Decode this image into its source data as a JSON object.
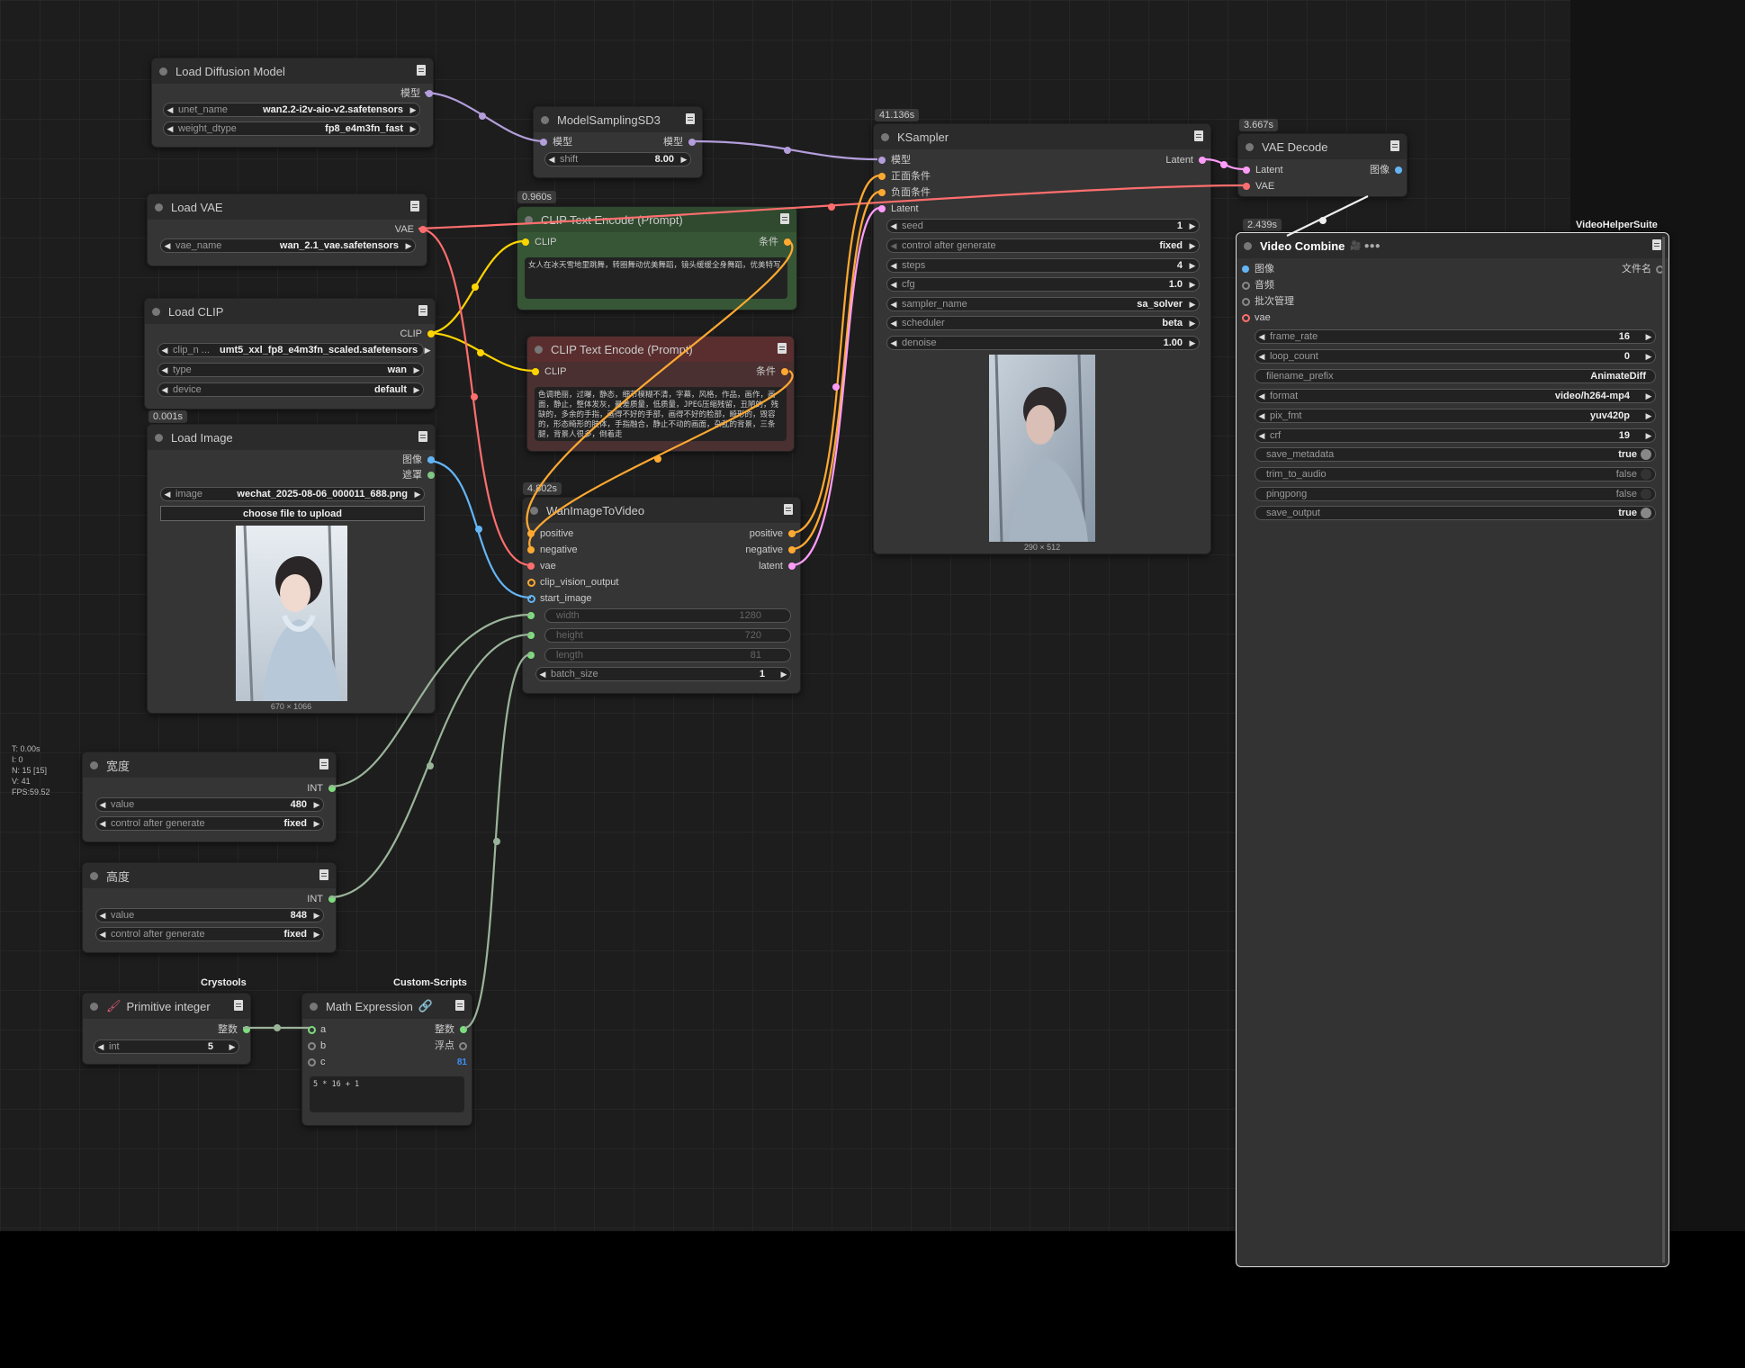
{
  "stats": [
    "T: 0.00s",
    "I: 0",
    "N: 15 [15]",
    "V: 41",
    "FPS:59.52"
  ],
  "colors": {
    "model": "#b39ddb",
    "clip": "#ffd500",
    "vae": "#ff6e6e",
    "conditioning": "#ffa931",
    "latent": "#ff9cf9",
    "image": "#64b5f6",
    "int": "#7cdd7c",
    "mask": "#81c784"
  },
  "nodes": {
    "load_diffusion": {
      "title": "Load Diffusion Model",
      "out": "模型",
      "w1_label": "unet_name",
      "w1_value": "wan2.2-i2v-aio-v2.safetensors",
      "w2_label": "weight_dtype",
      "w2_value": "fp8_e4m3fn_fast"
    },
    "model_sampling": {
      "title": "ModelSamplingSD3",
      "in": "模型",
      "out": "模型",
      "w_label": "shift",
      "w_value": "8.00"
    },
    "load_vae": {
      "title": "Load VAE",
      "out": "VAE",
      "w_label": "vae_name",
      "w_value": "wan_2.1_vae.safetensors"
    },
    "load_clip": {
      "title": "Load CLIP",
      "out": "CLIP",
      "w1_label": "clip_n ...",
      "w1_value": "umt5_xxl_fp8_e4m3fn_scaled.safetensors",
      "w2_label": "type",
      "w2_value": "wan",
      "w3_label": "device",
      "w3_value": "default"
    },
    "clip_pos": {
      "timer": "0.960s",
      "title": "CLIP Text Encode (Prompt)",
      "in": "CLIP",
      "out": "条件",
      "text": "女人在冰天雪地里跳舞，转圈舞动优美舞蹈，镜头缓缓全身舞蹈，优美特写"
    },
    "clip_neg": {
      "title": "CLIP Text Encode (Prompt)",
      "in": "CLIP",
      "out": "条件",
      "text": "色调艳丽，过曝，静态，细节模糊不清，字幕，风格，作品，画作，画面，静止，整体发灰，最差质量，低质量，JPEG压缩残留，丑陋的，残缺的，多余的手指，画得不好的手部，画得不好的脸部，畸形的，毁容的，形态畸形的肢体，手指融合，静止不动的画面，杂乱的背景，三条腿，背景人很多，倒着走"
    },
    "load_image": {
      "timer": "0.001s",
      "title": "Load Image",
      "out1": "图像",
      "out2": "遮罩",
      "w_label": "image",
      "w_value": "wechat_2025-08-06_000011_688.png",
      "button": "choose file to upload",
      "caption": "670 × 1066"
    },
    "wan": {
      "timer": "4.802s",
      "title": "WanImageToVideo",
      "in1": "positive",
      "in2": "negative",
      "in3": "vae",
      "in4": "clip_vision_output",
      "in5": "start_image",
      "out1": "positive",
      "out2": "negative",
      "out3": "latent",
      "w1_label": "width",
      "w1_value": "1280",
      "w2_label": "height",
      "w2_value": "720",
      "w3_label": "length",
      "w3_value": "81",
      "w4_label": "batch_size",
      "w4_value": "1"
    },
    "ksampler": {
      "timer": "41.136s",
      "title": "KSampler",
      "in1": "模型",
      "in2": "正面条件",
      "in3": "负面条件",
      "in4": "Latent",
      "out": "Latent",
      "widgets": [
        {
          "label": "seed",
          "value": "1"
        },
        {
          "label": "control after generate",
          "value": "fixed"
        },
        {
          "label": "steps",
          "value": "4"
        },
        {
          "label": "cfg",
          "value": "1.0"
        },
        {
          "label": "sampler_name",
          "value": "sa_solver"
        },
        {
          "label": "scheduler",
          "value": "beta"
        },
        {
          "label": "denoise",
          "value": "1.00"
        }
      ],
      "caption": "290 × 512"
    },
    "vae_decode": {
      "timer": "3.667s",
      "title": "VAE Decode",
      "in1": "Latent",
      "in2": "VAE",
      "out": "图像"
    },
    "video_combine": {
      "timer": "2.439s",
      "tag": "VideoHelperSuite",
      "title": "Video Combine",
      "in1": "图像",
      "in2": "音频",
      "in3": "批次管理",
      "in4": "vae",
      "out": "文件名",
      "widgets": [
        {
          "label": "frame_rate",
          "value": "16"
        },
        {
          "label": "loop_count",
          "value": "0"
        },
        {
          "label": "filename_prefix",
          "value": "AnimateDiff"
        },
        {
          "label": "format",
          "value": "video/h264-mp4"
        },
        {
          "label": "pix_fmt",
          "value": "yuv420p"
        },
        {
          "label": "crf",
          "value": "19"
        },
        {
          "label": "save_metadata",
          "value": "true"
        },
        {
          "label": "trim_to_audio",
          "value": "false"
        },
        {
          "label": "pingpong",
          "value": "false"
        },
        {
          "label": "save_output",
          "value": "true"
        }
      ]
    },
    "width_node": {
      "title": "宽度",
      "out": "INT",
      "w1_label": "value",
      "w1_value": "480",
      "w2_label": "control after generate",
      "w2_value": "fixed"
    },
    "height_node": {
      "title": "高度",
      "out": "INT",
      "w1_label": "value",
      "w1_value": "848",
      "w2_label": "control after generate",
      "w2_value": "fixed"
    },
    "primitive": {
      "tag": "Crystools",
      "title": "Primitive integer",
      "out": "整数",
      "w_label": "int",
      "w_value": "5"
    },
    "math": {
      "tag": "Custom-Scripts",
      "title": "Math Expression",
      "in1": "a",
      "in2": "b",
      "in3": "c",
      "out1": "整数",
      "out2": "浮点",
      "result": "81",
      "expr": "5 * 16 + 1"
    }
  }
}
